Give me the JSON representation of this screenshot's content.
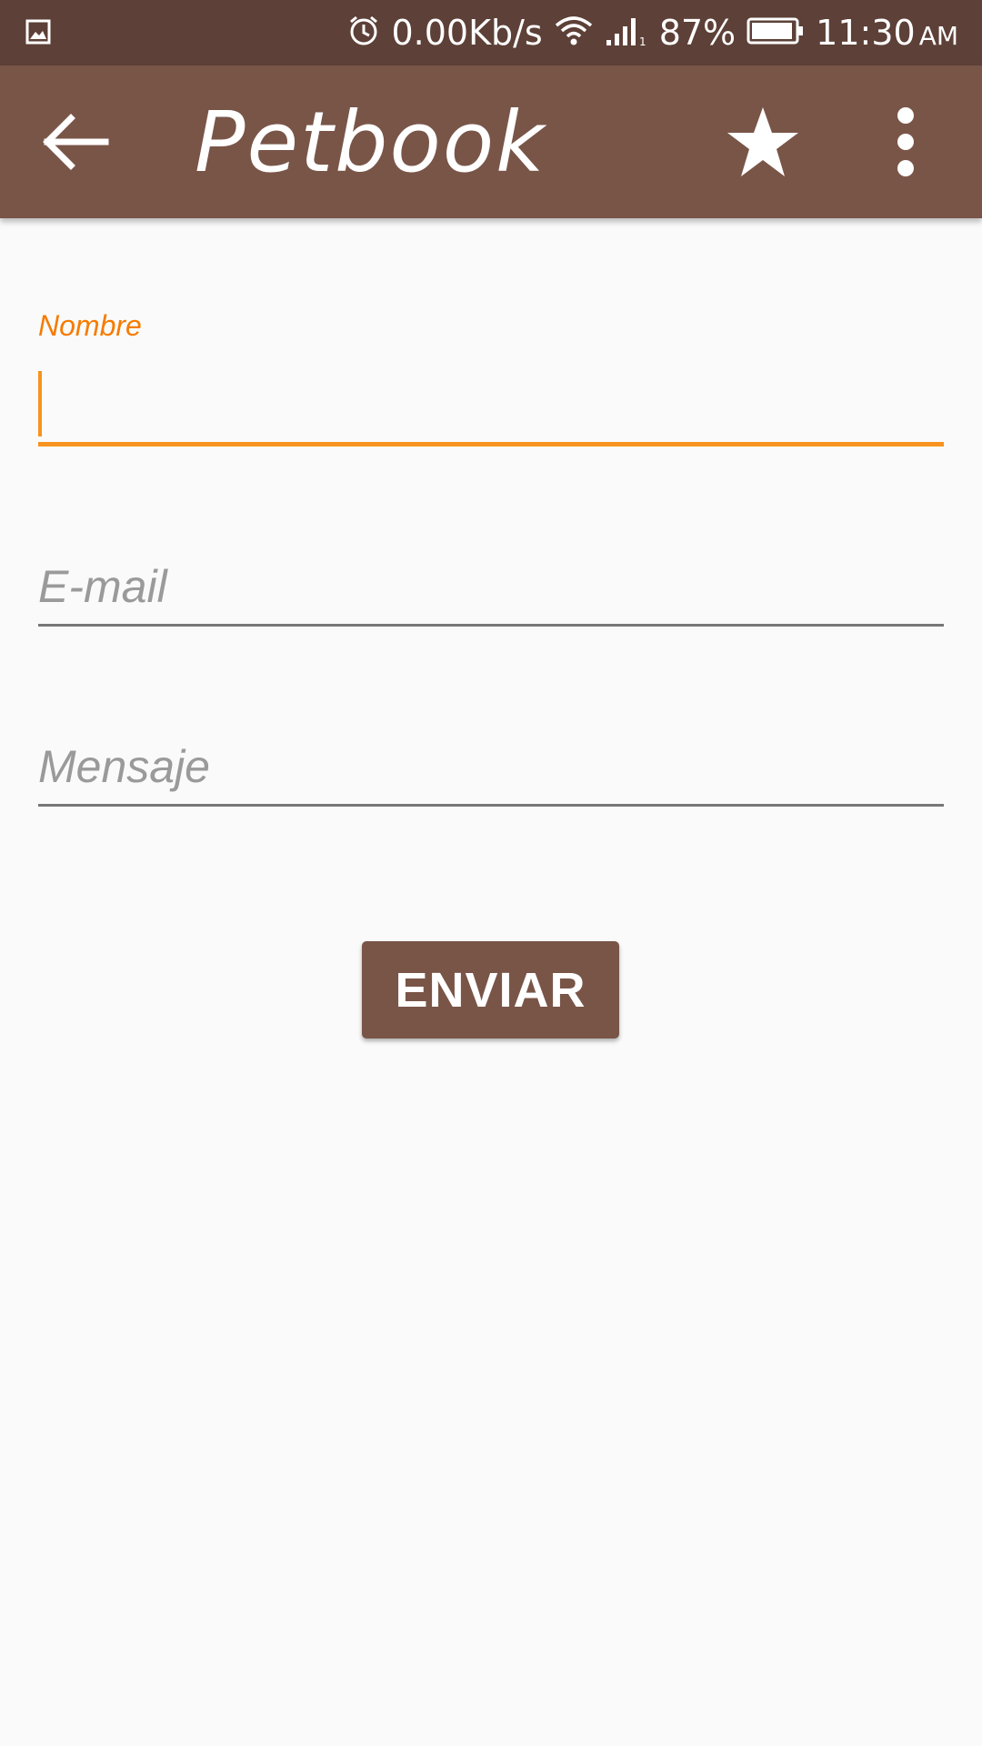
{
  "status_bar": {
    "network_speed": "0.00Kb/s",
    "battery_percent": "87%",
    "time": "11:30",
    "ampm": "AM",
    "icons": [
      "gallery-icon",
      "alarm-icon",
      "wifi-icon",
      "signal-icon",
      "battery-icon"
    ]
  },
  "app_bar": {
    "title": "Petbook",
    "icons": [
      "back-arrow-icon",
      "star-icon",
      "more-vert-icon"
    ]
  },
  "form": {
    "nombre": {
      "label": "Nombre",
      "value": ""
    },
    "email": {
      "placeholder": "E-mail"
    },
    "mensaje": {
      "placeholder": "Mensaje"
    },
    "submit_label": "ENVIAR"
  },
  "colors": {
    "status_bar": "#5d4037",
    "app_bar": "#795548",
    "accent": "#f7931e",
    "background": "#fafafa"
  }
}
